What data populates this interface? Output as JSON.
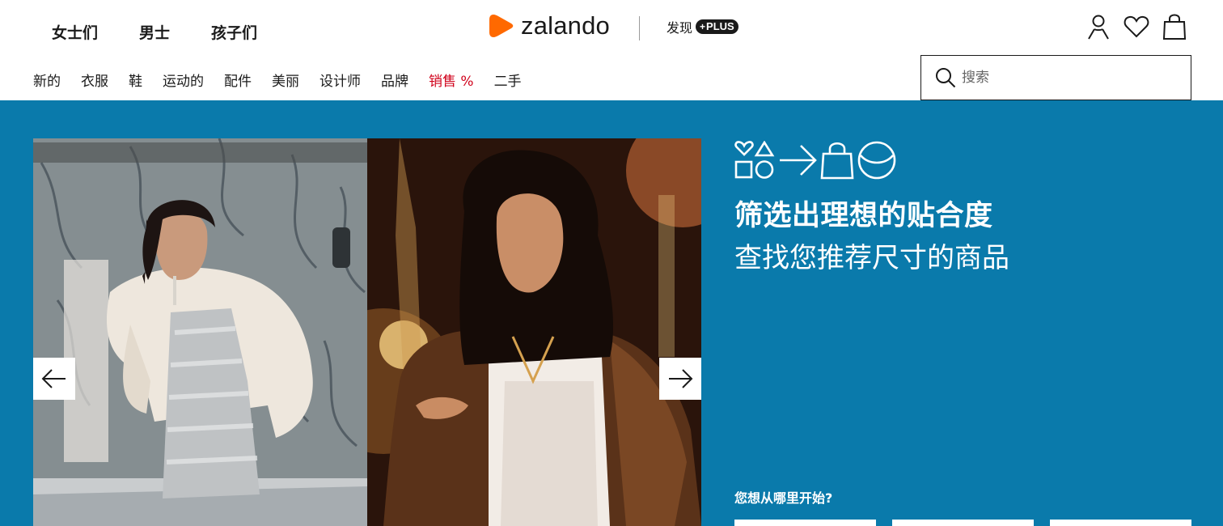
{
  "header": {
    "gender_nav": [
      "女士们",
      "男士",
      "孩子们"
    ],
    "logo_text": "zalando",
    "discover_label": "发现",
    "plus_label": "PLUS",
    "icons": [
      "user-icon",
      "heart-icon",
      "bag-icon"
    ],
    "categories": [
      "新的",
      "衣服",
      "鞋",
      "运动的",
      "配件",
      "美丽",
      "设计师",
      "品牌",
      "销售 %",
      "二手"
    ],
    "search": {
      "placeholder": "搜索"
    },
    "colors": {
      "logo_orange": "#ff6900",
      "sale_red": "#d0021b"
    }
  },
  "hero": {
    "background_color": "#0a7aab",
    "promo": {
      "icons": [
        "shapes-icon",
        "arrow-right-icon",
        "shopping-bag-icon",
        "smiley-icon"
      ],
      "title": "筛选出理想的贴合度",
      "subtitle": "查找您推荐尺寸的商品"
    },
    "start_question": "您想从哪里开始?",
    "carousel": {
      "prev_icon": "arrow-left-icon",
      "next_icon": "arrow-right-icon"
    }
  }
}
